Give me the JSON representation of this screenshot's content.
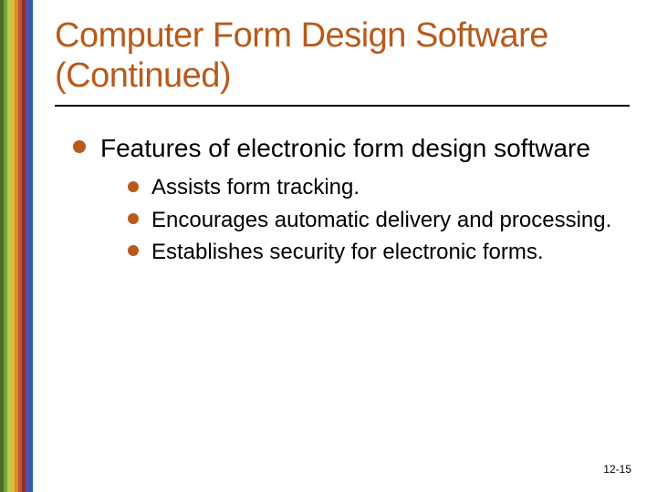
{
  "colors": {
    "accent": "#b85a1a",
    "stripes": [
      "#4a6b2a",
      "#7aa33d",
      "#b7cf4a",
      "#e7b93a",
      "#d98b2b",
      "#c5532d",
      "#8e2f2a",
      "#5a4f9e",
      "#2f5fa8"
    ]
  },
  "title": "Computer Form Design Software (Continued)",
  "bullets": {
    "lvl1": "Features of electronic form design software",
    "lvl2": [
      "Assists form tracking.",
      "Encourages automatic delivery and processing.",
      "Establishes security for electronic forms."
    ]
  },
  "page_number": "12-15"
}
